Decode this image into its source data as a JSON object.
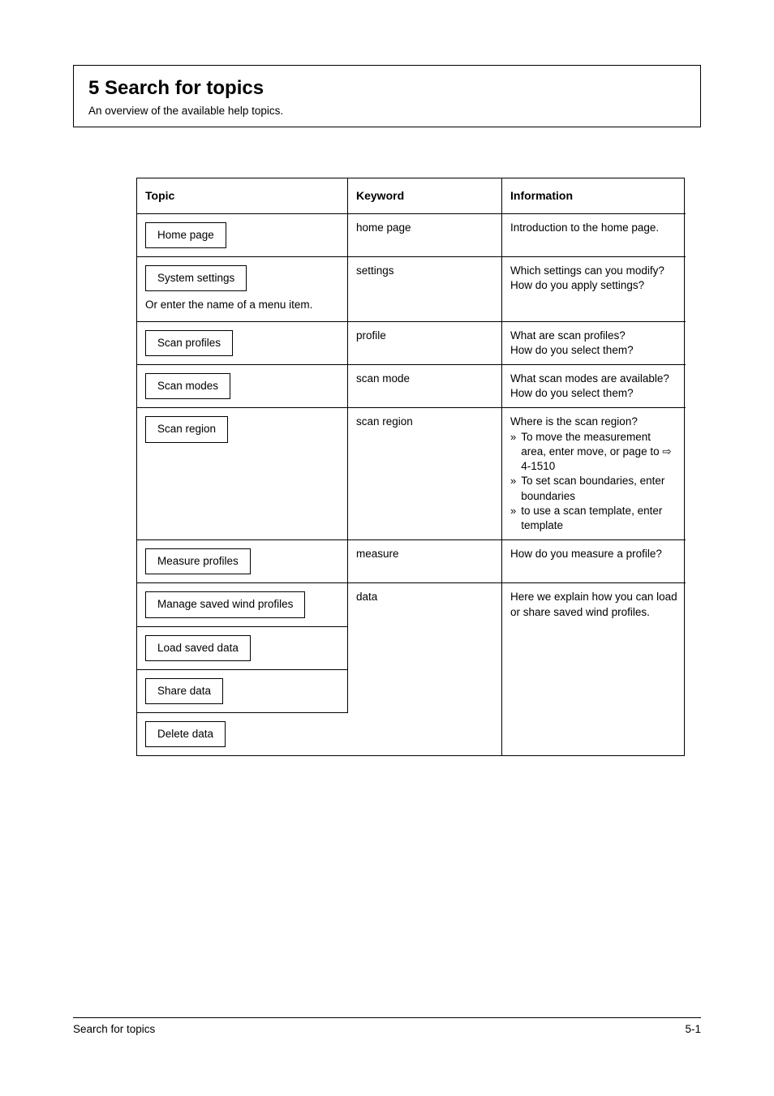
{
  "title": {
    "main": "5 Search for topics",
    "sub": "An overview of the available help topics."
  },
  "table": {
    "headers": [
      "Topic",
      "Keyword",
      "Information"
    ],
    "rows": [
      {
        "topic": "Home page",
        "keyword": "home page",
        "info": "Introduction to the home page."
      },
      {
        "topic": "System settings",
        "extra": "Or enter the name of a menu item.",
        "keyword": "settings",
        "info": [
          "Which settings can you modify?",
          "How do you apply settings?"
        ]
      },
      {
        "topic": "Scan profiles",
        "keyword": "profile",
        "info": [
          "What are scan profiles?",
          "How do you select them?"
        ]
      },
      {
        "topic": "Scan modes",
        "keyword": "scan mode",
        "info": [
          "What scan modes are available?",
          "How do you select them?"
        ]
      },
      {
        "topic": "Scan region",
        "keyword": "scan region",
        "info_block": {
          "lead": "Where is the scan region?",
          "bullets": [
            "To move the measurement area, enter move, or page to  4-1510",
            "To set scan boundaries, enter boundaries",
            "to use a scan template, enter template"
          ]
        }
      },
      {
        "topic": "Measure profiles",
        "keyword": "measure",
        "info": "How do you measure a profile?"
      },
      {
        "topic": "Manage saved wind profiles",
        "keyword": "data",
        "info_span": "Here we explain how you can load or share saved wind profiles.",
        "rowspan": 4
      },
      {
        "topic": "Load saved data"
      },
      {
        "topic": "Share data"
      },
      {
        "topic": "Delete data"
      }
    ]
  },
  "footer": {
    "left": "Search for topics",
    "right": "5-1"
  }
}
